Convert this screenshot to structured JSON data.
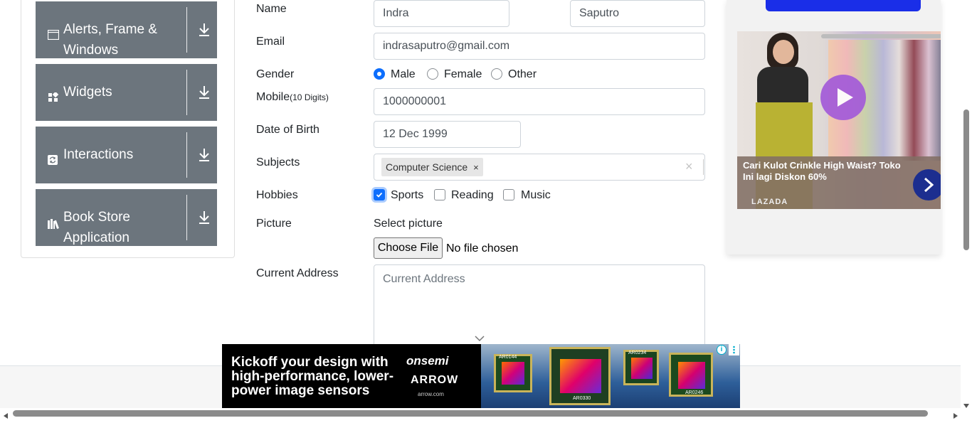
{
  "sidebar": {
    "groups": [
      {
        "title": "Alerts, Frame & Windows",
        "icon": "window-icon"
      },
      {
        "title": "Widgets",
        "icon": "widgets-icon"
      },
      {
        "title": "Interactions",
        "icon": "interactions-icon"
      },
      {
        "title": "Book Store Application",
        "icon": "book-icon"
      }
    ]
  },
  "form": {
    "name_label": "Name",
    "first_name_value": "Indra",
    "last_name_value": "Saputro",
    "email_label": "Email",
    "email_value": "indrasaputro@gmail.com",
    "gender_label": "Gender",
    "gender_options": [
      "Male",
      "Female",
      "Other"
    ],
    "gender_selected": "Male",
    "mobile_label": "Mobile",
    "mobile_hint": "(10 Digits)",
    "mobile_value": "1000000001",
    "dob_label": "Date of Birth",
    "dob_value": "12 Dec 1999",
    "subjects_label": "Subjects",
    "subject_tag": "Computer Science",
    "tag_remove": "×",
    "subjects_clear": "×",
    "hobbies_label": "Hobbies",
    "hobbies": [
      {
        "label": "Sports",
        "checked": true
      },
      {
        "label": "Reading",
        "checked": false
      },
      {
        "label": "Music",
        "checked": false
      }
    ],
    "picture_label": "Picture",
    "select_picture": "Select picture",
    "choose_file": "Choose File",
    "no_file": "No file chosen",
    "address_label": "Current Address",
    "address_placeholder": "Current Address"
  },
  "ads": {
    "right": {
      "headline": "Cari Kulot Crinkle High Waist? Toko Ini lagi Diskon 60%",
      "brand": "LAZADA"
    },
    "bottom": {
      "line1": "Kickoff your design with",
      "line2": "high-performance, lower-",
      "line3": "power image sensors",
      "brand1": "onsemi",
      "brand2": "ARROW",
      "brand2_url": "arrow.com",
      "chip_labels": [
        "AR0144",
        "AR0330",
        "AR0234",
        "AR0246"
      ]
    }
  },
  "colors": {
    "sidebar_header": "#6c757d",
    "primary": "#0d6efd",
    "input_border": "#ced4da"
  }
}
